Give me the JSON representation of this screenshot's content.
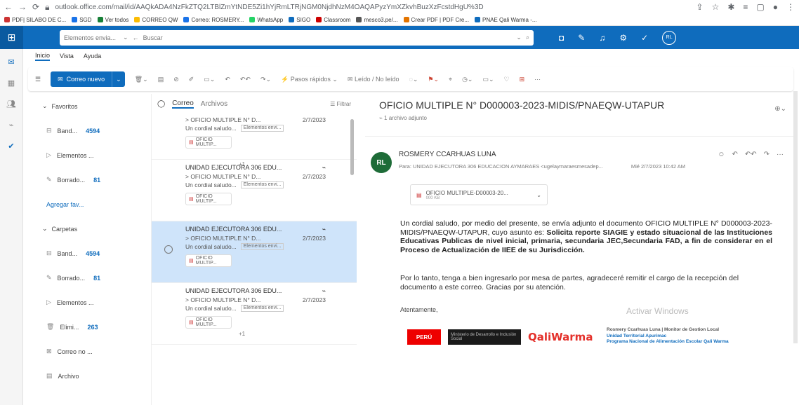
{
  "browser": {
    "url": "outlook.office.com/mail/id/AAQkADA4NzFkZTQ2LTBlZmYtNDE5Zi1hYjRmLTRjNGM0NjdhNzM4OAQAPyzYmXZkvhBuzXzFcstdHgU%3D",
    "bookmarks": [
      "PDF| SILABO DE C...",
      "SGD",
      "Ver todos",
      "CORREO QW",
      "Correo: ROSMERY...",
      "WhatsApp",
      "SIGO",
      "Classroom",
      "mesco3.pe/...",
      "Crear PDF | PDF Cre...",
      "PNAE Qali Warma -..."
    ],
    "bookmark_colors": [
      "#c33",
      "#1a73e8",
      "#188038",
      "#fbbc04",
      "#1a73e8",
      "#25d366",
      "#0f6cbd",
      "#c00",
      "#555",
      "#e37400",
      "#0f6cbd"
    ]
  },
  "header": {
    "search_scope": "Elementos envia...",
    "search_placeholder": "Buscar",
    "avatar": "RL"
  },
  "menu": [
    "Inicio",
    "Vista",
    "Ayuda"
  ],
  "toolbar": {
    "new_mail": "Correo nuevo",
    "quick_steps": "Pasos rápidos",
    "read_unread": "Leído / No leído"
  },
  "folders": [
    {
      "label": "Favoritos",
      "type": "section"
    },
    {
      "label": "Band...",
      "count": "4594",
      "icon": "inbox-icon"
    },
    {
      "label": "Elementos ...",
      "icon": "sent-icon"
    },
    {
      "label": "Borrado...",
      "count": "81",
      "icon": "drafts-icon"
    },
    {
      "label": "Agregar fav...",
      "type": "link"
    },
    {
      "label": "Carpetas",
      "type": "section"
    },
    {
      "label": "Band...",
      "count": "4594",
      "icon": "inbox-icon"
    },
    {
      "label": "Borrado...",
      "count": "81",
      "icon": "drafts-icon"
    },
    {
      "label": "Elementos ...",
      "icon": "sent-icon"
    },
    {
      "label": "Elimi...",
      "count": "263",
      "icon": "trash-icon"
    },
    {
      "label": "Correo no ...",
      "icon": "junk-icon"
    },
    {
      "label": "Archivo",
      "icon": "archive-icon"
    }
  ],
  "list": {
    "tab_mail": "Correo",
    "tab_files": "Archivos",
    "filter": "Filtrar",
    "items": [
      {
        "from": "",
        "subject": "> OFICIO MULTIPLE N° D...",
        "date": "2/7/2023",
        "preview": "Un cordial saludo...",
        "tag": "Elementos envi...",
        "att": "OFICIO MULTIP...",
        "plus": "+1"
      },
      {
        "from": "UNIDAD EJECUTORA 306 EDU...",
        "subject": "> OFICIO MULTIPLE N° D...",
        "date": "2/7/2023",
        "preview": "Un cordial saludo...",
        "tag": "Elementos envi...",
        "att": "OFICIO MULTIP...",
        "plus": ""
      },
      {
        "from": "UNIDAD EJECUTORA 306 EDU...",
        "subject": "> OFICIO MULTIPLE N° D...",
        "date": "2/7/2023",
        "preview": "Un cordial saludo...",
        "tag": "Elementos envi...",
        "att": "OFICIO MULTIP...",
        "plus": ""
      },
      {
        "from": "UNIDAD EJECUTORA 306 EDU...",
        "subject": "> OFICIO MULTIPLE N° D...",
        "date": "2/7/2023",
        "preview": "Un cordial saludo...",
        "tag": "Elementos envi...",
        "att": "OFICIO MULTIP...",
        "plus": "+1"
      }
    ]
  },
  "reading": {
    "title": "OFICIO MULTIPLE N° D000003-2023-MIDIS/PNAEQW-UTAPUR",
    "attach_count": "1 archivo adjunto",
    "avatar": "RL",
    "sender": "ROSMERY CCARHUAS LUNA",
    "to": "Para: UNIDAD EJECUTORA 306 EDUCACION AYMARAES <ugelaymaraesmesadep...",
    "date": "Mié 2/7/2023 10:42 AM",
    "attachment_name": "OFICIO MULTIPLE-D00003-20...",
    "attachment_size": "000 KB",
    "body_intro": "Un cordial saludo, por medio del presente, se envía adjunto el documento OFICIO MULTIPLE N° D000003-2023-MIDIS/PNAEQW-UTAPUR, cuyo asunto es:",
    "body_bold": "Solicita reporte SIAGIE y estado situacional de las Instituciones Educativas Publicas de nivel inicial, primaria, secundaria JEC,Secundaria FAD, a fin de considerar en el Proceso de Actualización de IIEE de su Jurisdicción.",
    "body_p2": "Por lo tanto, tenga a bien ingresarlo por mesa de partes, agradeceré remitir el cargo de la recepción del documento a este correo. Gracias por su atención.",
    "regards": "Atentamente,",
    "watermark": "Activar Windows",
    "logo_peru": "PERÚ",
    "logo_midis": "Ministerio de Desarrollo e Inclusión Social",
    "logo_qw": "QaliWarma",
    "sig_line1": "Rosmery Ccarhuas Luna | Monitor de Gestion Local",
    "sig_line2": "Unidad Territorial Apurimac",
    "sig_line3": "Programa Nacional de Alimentación Escolar Qali Warma"
  }
}
